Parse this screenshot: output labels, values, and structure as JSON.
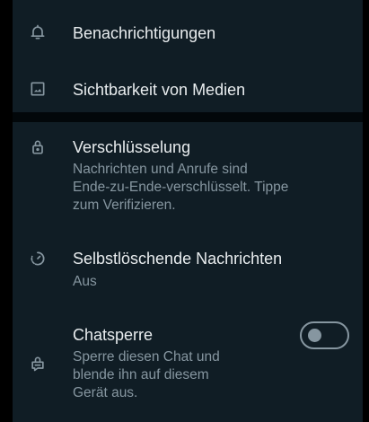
{
  "settings": {
    "notifications": {
      "icon": "bell-icon",
      "label": "Benachrichtigungen"
    },
    "media_visibility": {
      "icon": "image-icon",
      "label": "Sichtbarkeit von Medien"
    },
    "encryption": {
      "icon": "lock-icon",
      "label": "Verschlüsselung",
      "lines": [
        "Nachrichten und Anrufe sind",
        "Ende-zu-Ende-verschlüsselt. Tippe",
        "zum Verifizieren."
      ]
    },
    "disappearing": {
      "icon": "timer-icon",
      "label": "Selbstlöschende Nachrichten",
      "value": "Aus"
    },
    "chat_lock": {
      "icon": "chat-lock-icon",
      "label": "Chatsperre",
      "lines": [
        "Sperre diesen Chat und",
        "blende ihn auf diesem",
        "Gerät aus."
      ],
      "enabled": false
    }
  },
  "colors": {
    "background": "#101d25",
    "text_primary": "#e9edef",
    "text_secondary": "#8696a0"
  }
}
